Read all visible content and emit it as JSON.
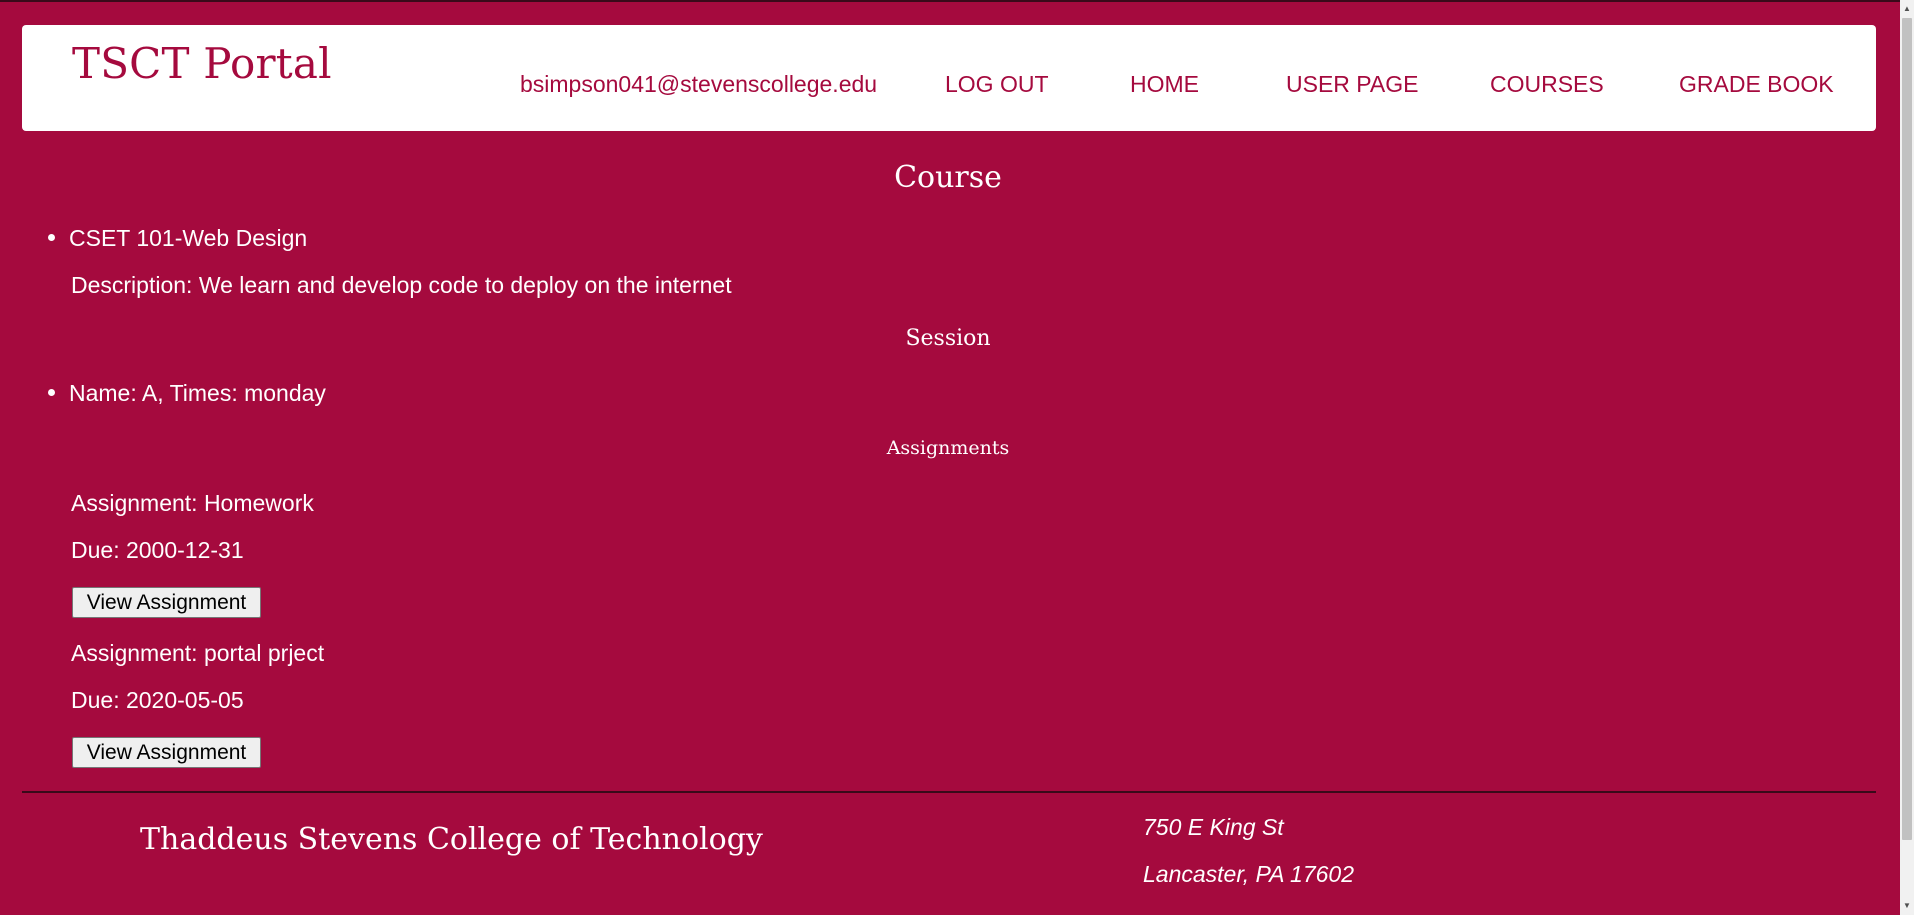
{
  "header": {
    "brand": "TSCT Portal",
    "nav": {
      "email": "bsimpson041@stevenscollege.edu",
      "logout": "LOG OUT",
      "home": "HOME",
      "user_page": "USER PAGE",
      "courses": "COURSES",
      "grade_book": "GRADE BOOK"
    }
  },
  "course": {
    "heading": "Course",
    "name": "CSET 101-Web Design",
    "description": "Description: We learn and develop code to deploy on the internet"
  },
  "session": {
    "heading": "Session",
    "item": "Name: A, Times: monday"
  },
  "assignments": {
    "heading": "Assignments",
    "items": [
      {
        "name": "Assignment: Homework",
        "due": "Due: 2000-12-31",
        "button": "View Assignment"
      },
      {
        "name": "Assignment: portal prject",
        "due": "Due: 2020-05-05",
        "button": "View Assignment"
      }
    ]
  },
  "footer": {
    "college": "Thaddeus Stevens College of Technology",
    "address_line1": "750 E King St",
    "address_line2": "Lancaster, PA 17602"
  },
  "colors": {
    "background": "#a50a3e",
    "header_bg": "#ffffff",
    "accent_text": "#a50a3e"
  }
}
